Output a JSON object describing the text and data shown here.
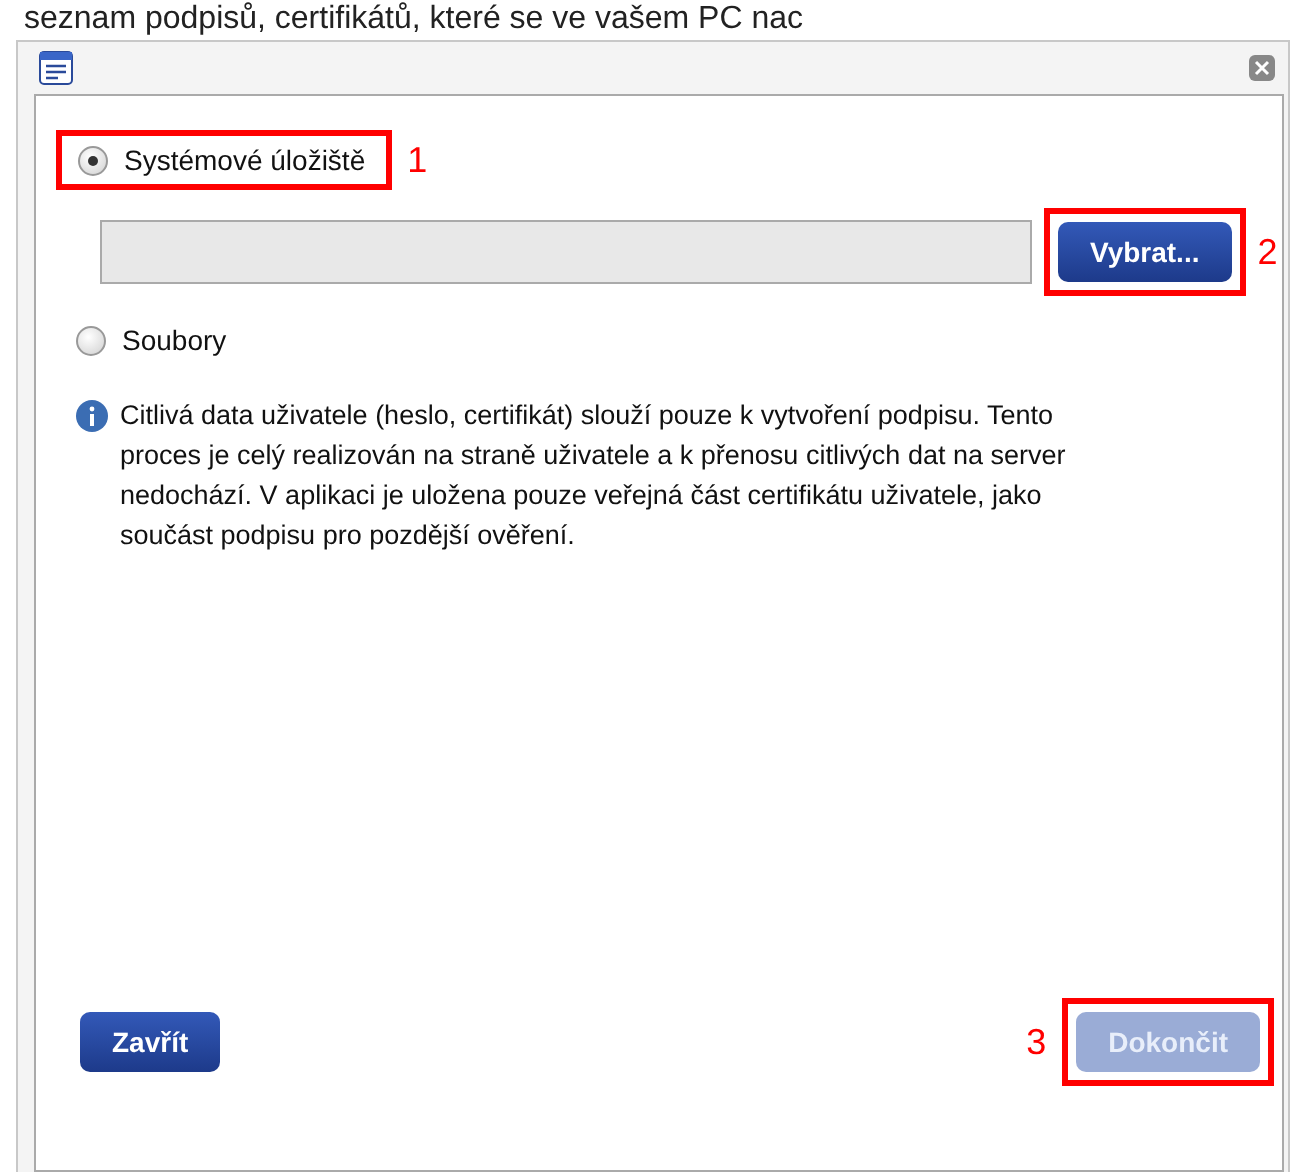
{
  "caption": "seznam podpisů, certifikátů, které se ve vašem PC nac",
  "options": [
    {
      "label": "Systémové úložiště",
      "selected": true,
      "callout": "1"
    },
    {
      "label": "Soubory",
      "selected": false
    }
  ],
  "browse_button": {
    "label": "Vybrat...",
    "callout": "2"
  },
  "info": "Citlivá data uživatele (heslo, certifikát) slouží pouze k vytvoření podpisu. Tento proces je celý realizován na straně uživatele a k přenosu citlivých dat na server nedochází. V aplikaci je uložena pouze veřejná část certifikátu uživatele, jako součást podpisu pro pozdější ověření.",
  "buttons": [
    {
      "label": "Zavřít",
      "disabled": false
    },
    {
      "label": "Dokončit",
      "disabled": true,
      "callout": "3"
    }
  ]
}
